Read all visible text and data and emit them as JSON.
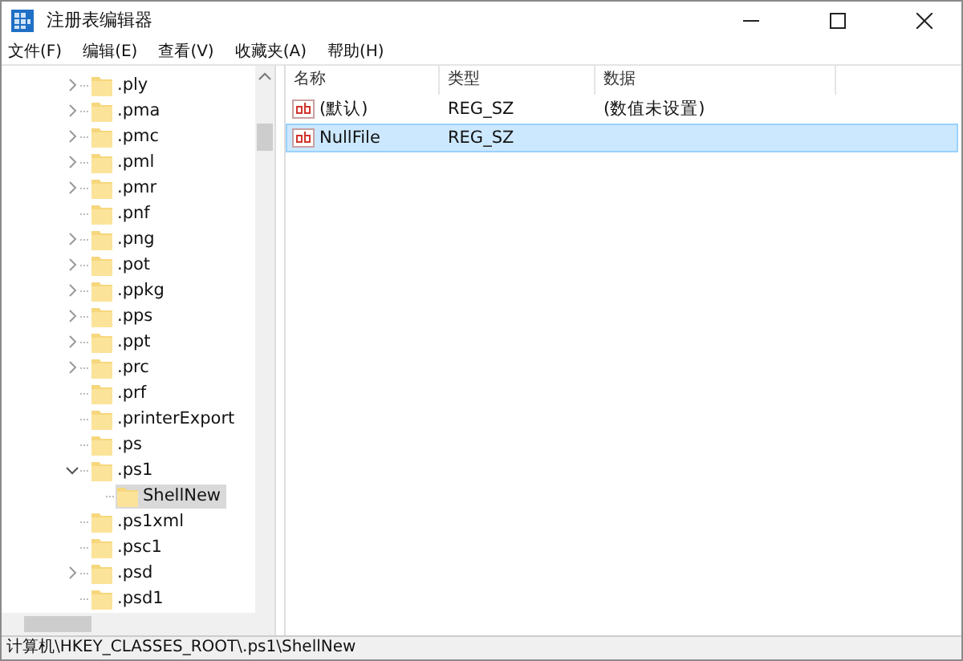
{
  "window": {
    "title": "注册表编辑器"
  },
  "menu": [
    "文件(F)",
    "编辑(E)",
    "查看(V)",
    "收藏夹(A)",
    "帮助(H)"
  ],
  "tree": {
    "items": [
      {
        "label": ".ply",
        "expanded": false,
        "selected": false
      },
      {
        "label": ".pma",
        "expanded": false,
        "selected": false
      },
      {
        "label": ".pmc",
        "expanded": false,
        "selected": false
      },
      {
        "label": ".pml",
        "expanded": false,
        "selected": false
      },
      {
        "label": ".pmr",
        "expanded": false,
        "selected": false
      },
      {
        "label": ".pnf",
        "selected": false
      },
      {
        "label": ".png",
        "expanded": false,
        "selected": false
      },
      {
        "label": ".pot",
        "expanded": false,
        "selected": false
      },
      {
        "label": ".ppkg",
        "expanded": false,
        "selected": false
      },
      {
        "label": ".pps",
        "expanded": false,
        "selected": false
      },
      {
        "label": ".ppt",
        "expanded": false,
        "selected": false
      },
      {
        "label": ".prc",
        "expanded": false,
        "selected": false
      },
      {
        "label": ".prf",
        "selected": false
      },
      {
        "label": ".printerExport",
        "selected": false
      },
      {
        "label": ".ps",
        "selected": false
      },
      {
        "label": ".ps1",
        "expanded": true,
        "selected": false,
        "children": [
          {
            "label": "ShellNew",
            "selected": true
          }
        ]
      },
      {
        "label": ".ps1xml",
        "selected": false
      },
      {
        "label": ".psc1",
        "selected": false
      },
      {
        "label": ".psd",
        "expanded": false,
        "selected": false
      },
      {
        "label": ".psd1",
        "selected": false
      }
    ]
  },
  "values": {
    "columns": [
      "名称",
      "类型",
      "数据"
    ],
    "rows": [
      {
        "name": "(默认)",
        "type": "REG_SZ",
        "data": "(数值未设置)",
        "selected": false
      },
      {
        "name": "NullFile",
        "type": "REG_SZ",
        "selected": true
      }
    ]
  },
  "status_bar": "计算机\\HKEY_CLASSES_ROOT\\.ps1\\ShellNew"
}
